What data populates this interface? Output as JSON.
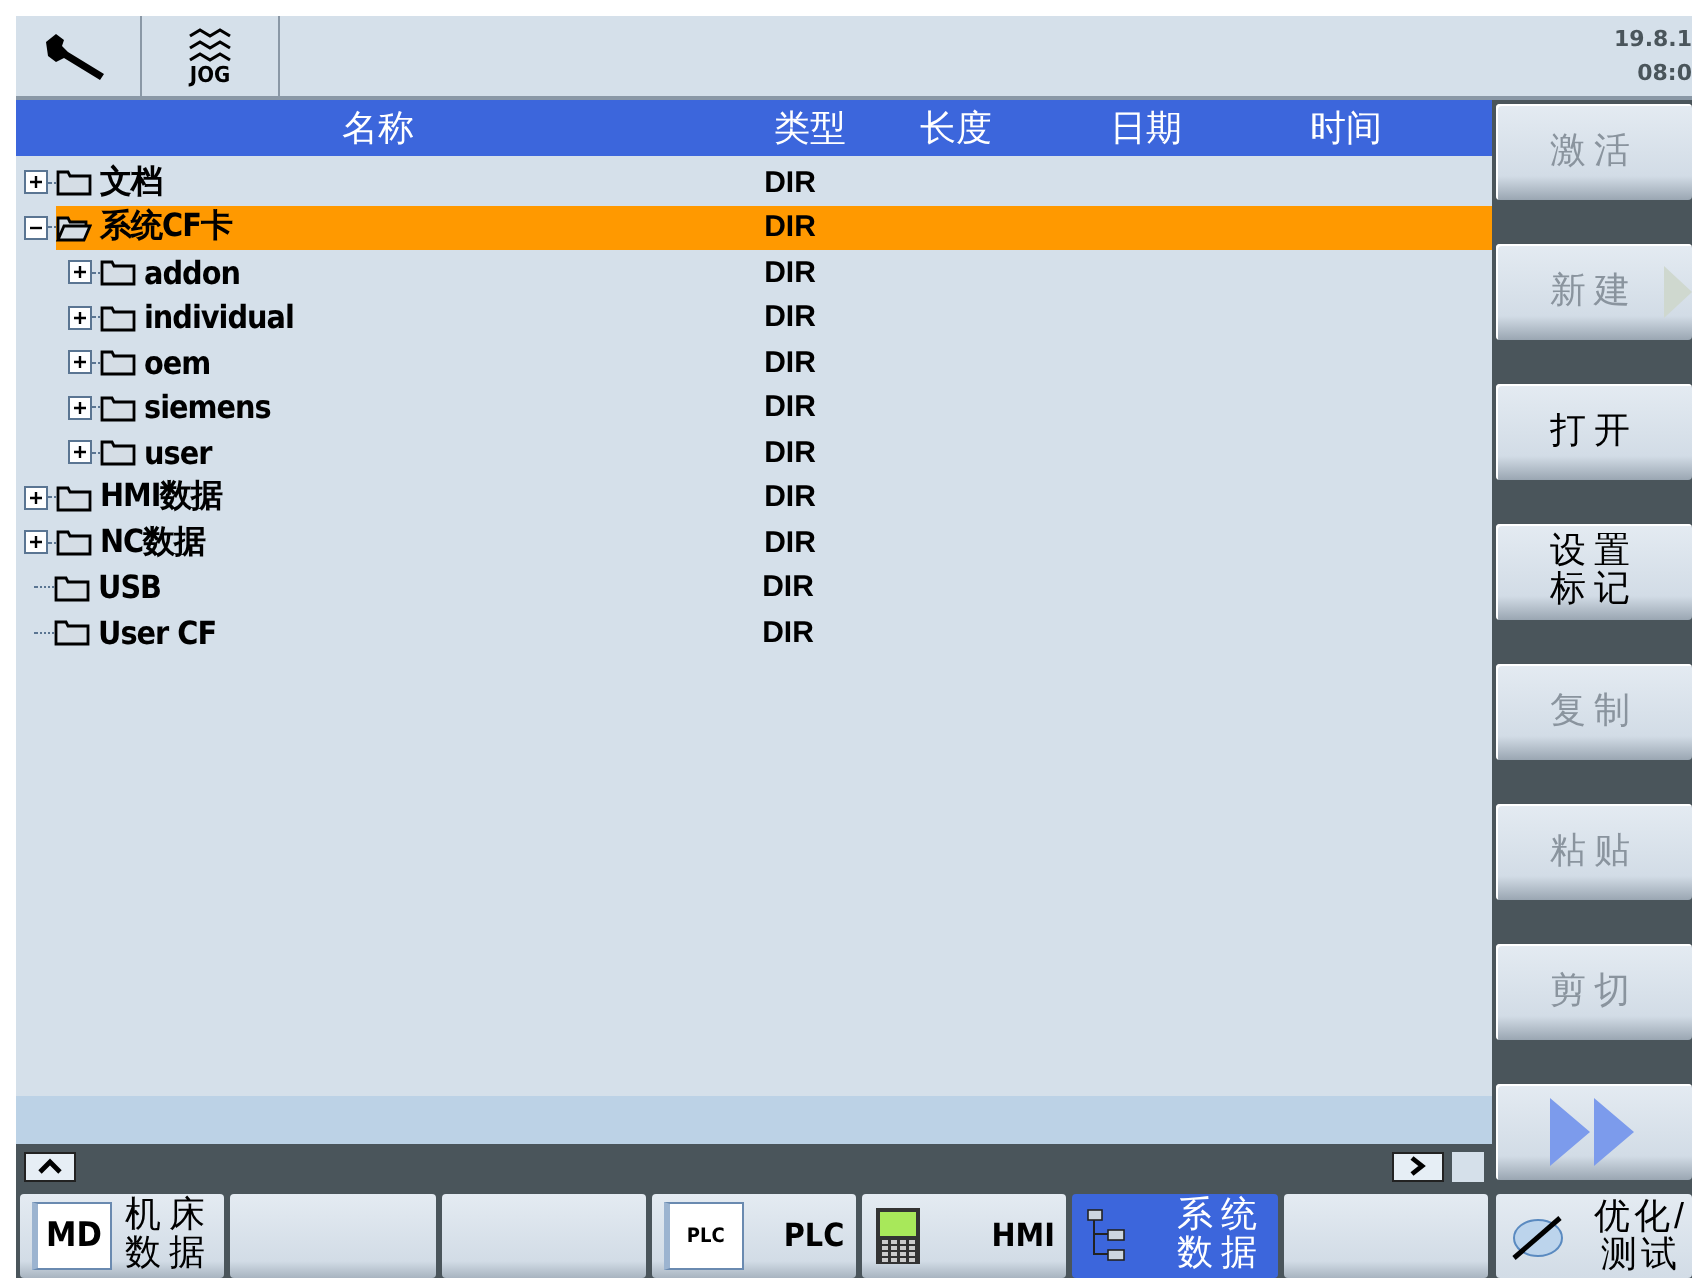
{
  "header": {
    "mode": "JOG",
    "date": "19.8.1",
    "time": "08:0"
  },
  "table": {
    "columns": [
      "名称",
      "类型",
      "长度",
      "日期",
      "时间"
    ],
    "rows": [
      {
        "name": "文档",
        "type": "DIR",
        "expanded": false,
        "selected": false
      },
      {
        "name": "系统CF卡",
        "type": "DIR",
        "expanded": true,
        "selected": true,
        "children": [
          {
            "name": "addon",
            "type": "DIR",
            "expanded": false,
            "selected": false
          },
          {
            "name": "individual",
            "type": "DIR",
            "expanded": false,
            "selected": false
          },
          {
            "name": "oem",
            "type": "DIR",
            "expanded": false,
            "selected": false
          },
          {
            "name": "siemens",
            "type": "DIR",
            "expanded": false,
            "selected": false
          },
          {
            "name": "user",
            "type": "DIR",
            "expanded": false,
            "selected": false
          }
        ]
      },
      {
        "name": "HMI数据",
        "type": "DIR",
        "expanded": false,
        "selected": false
      },
      {
        "name": "NC数据",
        "type": "DIR",
        "expanded": false,
        "selected": false
      },
      {
        "name": "USB",
        "type": "DIR",
        "selected": false
      },
      {
        "name": "User CF",
        "type": "DIR",
        "selected": false
      }
    ]
  },
  "side_keys": [
    {
      "kind": "text",
      "label": "激活",
      "disabled": true
    },
    {
      "kind": "menu",
      "label": "新建",
      "disabled": true
    },
    {
      "kind": "text",
      "label": "打开",
      "disabled": false
    },
    {
      "kind": "text",
      "lines": [
        "设置",
        "标记"
      ],
      "disabled": false
    },
    {
      "kind": "text",
      "label": "复制",
      "disabled": true
    },
    {
      "kind": "text",
      "label": "粘贴",
      "disabled": true
    },
    {
      "kind": "text",
      "label": "剪切",
      "disabled": true
    },
    {
      "kind": "more"
    }
  ],
  "bottom_keys": [
    {
      "kind": "md",
      "icon_label": "MD",
      "lines": [
        "机床",
        "数据"
      ],
      "selected": false
    },
    {
      "kind": "empty",
      "selected": false
    },
    {
      "kind": "empty",
      "selected": false
    },
    {
      "kind": "plc",
      "icon_label": "PLC",
      "label": "PLC",
      "selected": false
    },
    {
      "kind": "hmi",
      "label": "HMI",
      "selected": false
    },
    {
      "kind": "tree",
      "lines": [
        "系统",
        "数据"
      ],
      "selected": true
    },
    {
      "kind": "empty",
      "selected": false
    }
  ],
  "corner_key": {
    "lines": [
      "优化/",
      "测试"
    ]
  }
}
